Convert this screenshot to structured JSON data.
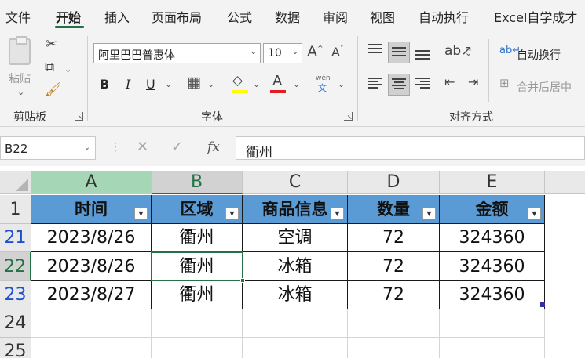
{
  "menu": {
    "tabs": [
      "文件",
      "开始",
      "插入",
      "页面布局",
      "公式",
      "数据",
      "审阅",
      "视图",
      "自动执行",
      "Excel自学成才"
    ],
    "active": "开始"
  },
  "ribbon": {
    "clipboard": {
      "paste_label": "粘贴",
      "group_label": "剪贴板"
    },
    "font": {
      "font_name": "阿里巴巴普惠体",
      "font_size": "10",
      "bold": "B",
      "italic": "I",
      "underline": "U",
      "increase_font": "A",
      "decrease_font": "A",
      "font_color_glyph": "A",
      "pinyin_top": "wén",
      "pinyin_bottom": "文",
      "group_label": "字体"
    },
    "alignment": {
      "wrap_text": "自动换行",
      "merge_center": "合并后居中",
      "group_label": "对齐方式"
    }
  },
  "formula_bar": {
    "name_box": "B22",
    "fx": "fx",
    "content": "衢州"
  },
  "grid": {
    "columns": [
      "A",
      "B",
      "C",
      "D",
      "E"
    ],
    "row_numbers": [
      "1",
      "21",
      "22",
      "23",
      "24",
      "25"
    ],
    "headers": [
      "时间",
      "区域",
      "商品信息",
      "数量",
      "金额"
    ],
    "rows": [
      [
        "2023/8/26",
        "衢州",
        "空调",
        "72",
        "324360"
      ],
      [
        "2023/8/26",
        "衢州",
        "冰箱",
        "72",
        "324360"
      ],
      [
        "2023/8/27",
        "衢州",
        "冰箱",
        "72",
        "324360"
      ]
    ],
    "selected_cell": "B22"
  },
  "colors": {
    "accent": "#217346",
    "header_fill": "#5b9bd5",
    "filtered_row_number": "#1f4fd1",
    "font_color_bar": "#e02020",
    "highlight_bar": "#ffff00"
  }
}
